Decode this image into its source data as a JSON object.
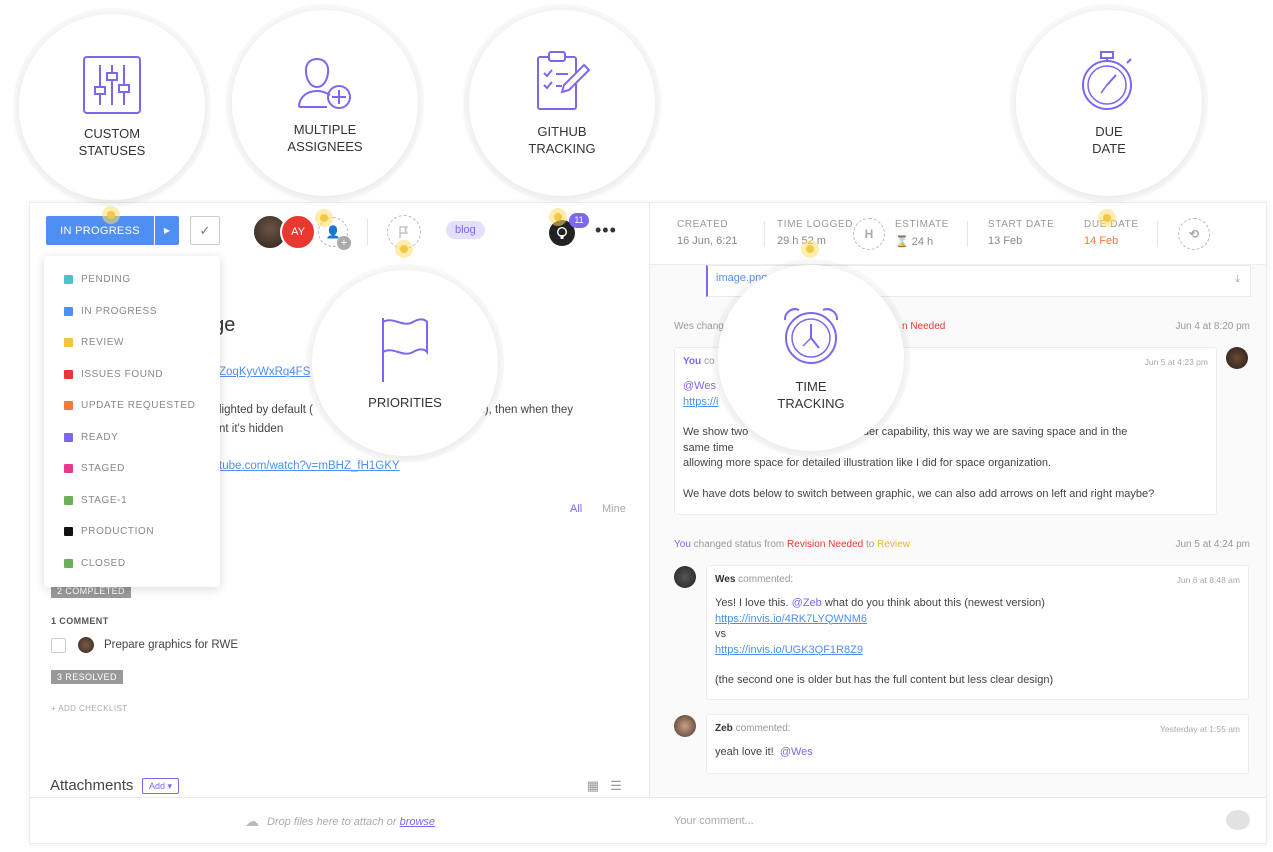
{
  "callouts": {
    "custom_statuses": "CUSTOM\nSTATUSES",
    "multiple_assignees": "MULTIPLE\nASSIGNEES",
    "github_tracking": "GITHUB\nTRACKING",
    "due_date": "DUE\nDATE",
    "priorities": "PRIORITIES",
    "time_tracking": "TIME\nTRACKING"
  },
  "toolbar": {
    "status_label": "IN PROGRESS",
    "assignee_initials": "AY",
    "tag": "blog",
    "github_count": "11",
    "more": "•••"
  },
  "statuses": [
    {
      "label": "PENDING",
      "color": "#4fc1c9"
    },
    {
      "label": "IN PROGRESS",
      "color": "#4f8ef3"
    },
    {
      "label": "REVIEW",
      "color": "#f5c242"
    },
    {
      "label": "ISSUES FOUND",
      "color": "#e8382f"
    },
    {
      "label": "UPDATE REQUESTED",
      "color": "#f07b39"
    },
    {
      "label": "READY",
      "color": "#7b68ee"
    },
    {
      "label": "STAGED",
      "color": "#e9378f"
    },
    {
      "label": "STAGE-1",
      "color": "#6bb05d"
    },
    {
      "label": "PRODUCTION",
      "color": "#111111"
    },
    {
      "label": "CLOSED",
      "color": "#6bb05d"
    }
  ],
  "task": {
    "title_fragment": "age",
    "link1_fragment": "ZoqKyvWxRq4FS",
    "desc_line1": "lighted by default (",
    "desc_line1_end": "ed), then when they",
    "desc_line2": "nt it's hidden",
    "link2_fragment": "tube.com/watch?v=mBHZ_fH1GKY",
    "filter_all": "All",
    "filter_mine": "Mine",
    "completed_pill": "2 COMPLETED",
    "comment_count": "1 COMMENT",
    "checklist_item": "Prepare graphics for RWE",
    "resolved_pill": "3 RESOLVED",
    "add_checklist": "+ ADD CHECKLIST",
    "attachments_title": "Attachments",
    "attachments_add": "Add ▾",
    "drop_text": "Drop files here to attach or",
    "drop_browse": "browse"
  },
  "meta": {
    "created_label": "CREATED",
    "created_value": "16 Jun, 6:21",
    "time_logged_label": "TIME LOGGED",
    "time_logged_value": "29 h 52 m",
    "estimate_label": "ESTIMATE",
    "estimate_value": "24 h",
    "start_label": "START DATE",
    "start_value": "13 Feb",
    "due_label": "DUE DATE",
    "due_value": "14 Feb"
  },
  "activity": {
    "file_name": "image.png",
    "wes_changed": "Wes chang",
    "wes_changed_end": "n Needed",
    "wes_changed_time": "Jun 4 at 8:20 pm",
    "c1_author": "You",
    "c1_verb": "co",
    "c1_time": "Jun 5 at 4:23 pm",
    "c1_mention": "@Wes",
    "c1_link": "https://i",
    "c1_p1a": "We show two",
    "c1_p1b": "th slider capability, this way we are saving space and in the",
    "c1_p1c": "same time",
    "c1_p2": "allowing more space for detailed illustration like I did for space organization.",
    "c1_p3": "We have dots below to switch between graphic, we can also add arrows on left and right maybe?",
    "status_you": "You",
    "status_changed": "changed status from",
    "status_from": "Revision Needed",
    "status_to_word": "to",
    "status_to": "Review",
    "status_time": "Jun 5 at 4:24 pm",
    "c2_author": "Wes",
    "c2_verb": "commented:",
    "c2_time": "Jun 6 at 8:48 am",
    "c2_l1a": "Yes! I love this.",
    "c2_l1_mention": "@Zeb",
    "c2_l1b": "what do you think about this (newest version)",
    "c2_link1": "https://invis.io/4RK7LYQWNM6",
    "c2_vs": "vs",
    "c2_link2": "https://invis.io/UGK3QF1R8Z9",
    "c2_l5": "(the second one is older but has the full content but less clear design)",
    "c3_author": "Zeb",
    "c3_verb": "commented:",
    "c3_time": "Yesterday at 1:55 am",
    "c3_text": "yeah love it!",
    "c3_mention": "@Wes",
    "comment_placeholder": "Your comment..."
  }
}
